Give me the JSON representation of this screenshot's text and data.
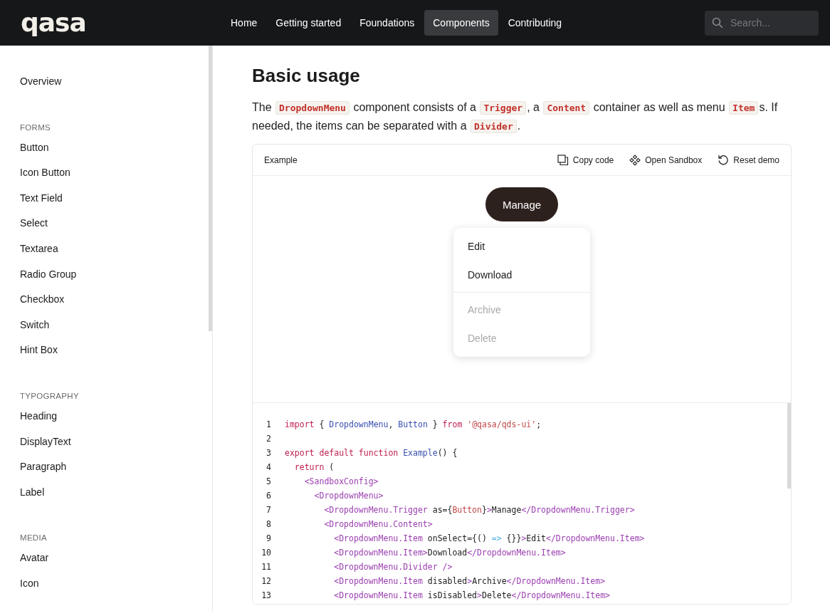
{
  "header": {
    "logo": "qasa",
    "nav": [
      {
        "label": "Home",
        "selected": false
      },
      {
        "label": "Getting started",
        "selected": false
      },
      {
        "label": "Foundations",
        "selected": false
      },
      {
        "label": "Components",
        "selected": true
      },
      {
        "label": "Contributing",
        "selected": false
      }
    ],
    "search": {
      "placeholder": "Search..."
    }
  },
  "sidebar": {
    "sections": [
      {
        "items": [
          {
            "label": "Overview"
          }
        ]
      },
      {
        "title": "FORMS",
        "items": [
          {
            "label": "Button"
          },
          {
            "label": "Icon Button"
          },
          {
            "label": "Text Field"
          },
          {
            "label": "Select"
          },
          {
            "label": "Textarea"
          },
          {
            "label": "Radio Group"
          },
          {
            "label": "Checkbox"
          },
          {
            "label": "Switch"
          },
          {
            "label": "Hint Box"
          }
        ]
      },
      {
        "title": "TYPOGRAPHY",
        "items": [
          {
            "label": "Heading"
          },
          {
            "label": "DisplayText"
          },
          {
            "label": "Paragraph"
          },
          {
            "label": "Label"
          }
        ]
      },
      {
        "title": "MEDIA",
        "items": [
          {
            "label": "Avatar"
          },
          {
            "label": "Icon"
          }
        ]
      }
    ]
  },
  "content": {
    "heading": "Basic usage",
    "paragraph": [
      {
        "kind": "text",
        "text": "The "
      },
      {
        "kind": "code",
        "text": "DropdownMenu"
      },
      {
        "kind": "text",
        "text": " component consists of a "
      },
      {
        "kind": "code",
        "text": "Trigger"
      },
      {
        "kind": "text",
        "text": ", a "
      },
      {
        "kind": "code",
        "text": "Content"
      },
      {
        "kind": "text",
        "text": " container as well as menu "
      },
      {
        "kind": "code",
        "text": "Item"
      },
      {
        "kind": "text",
        "text": "s. If needed, the items can be separated with a "
      },
      {
        "kind": "code",
        "text": "Divider"
      },
      {
        "kind": "text",
        "text": "."
      }
    ],
    "example": {
      "title": "Example",
      "actions": [
        {
          "kind": "copy",
          "label": "Copy code"
        },
        {
          "kind": "sandbox",
          "label": "Open Sandbox"
        },
        {
          "kind": "reset",
          "label": "Reset demo"
        }
      ],
      "trigger": "Manage",
      "menu": [
        {
          "kind": "item",
          "label": "Edit",
          "disabled": false
        },
        {
          "kind": "item",
          "label": "Download",
          "disabled": false
        },
        {
          "kind": "divider"
        },
        {
          "kind": "item",
          "label": "Archive",
          "disabled": true
        },
        {
          "kind": "item",
          "label": "Delete",
          "disabled": true
        }
      ],
      "code": [
        {
          "number": "1",
          "tokens": [
            {
              "kind": "kw",
              "text": "import"
            },
            {
              "kind": "plain",
              "text": " { "
            },
            {
              "kind": "name",
              "text": "DropdownMenu"
            },
            {
              "kind": "plain",
              "text": ", "
            },
            {
              "kind": "name",
              "text": "Button"
            },
            {
              "kind": "plain",
              "text": " } "
            },
            {
              "kind": "kw",
              "text": "from"
            },
            {
              "kind": "str",
              "text": " '@qasa/qds-ui'"
            },
            {
              "kind": "plain",
              "text": ";"
            }
          ]
        },
        {
          "number": "2"
        },
        {
          "number": "3",
          "tokens": [
            {
              "kind": "kw",
              "text": "export default function"
            },
            {
              "kind": "name",
              "text": " Example"
            },
            {
              "kind": "plain",
              "text": "() {"
            }
          ]
        },
        {
          "number": "4",
          "tokens": [
            {
              "kind": "kw",
              "text": "  return"
            },
            {
              "kind": "plain",
              "text": " ("
            }
          ]
        },
        {
          "number": "5",
          "tokens": [
            {
              "kind": "tag",
              "text": "    <SandboxConfig>"
            }
          ]
        },
        {
          "number": "6",
          "tokens": [
            {
              "kind": "tag",
              "text": "      <DropdownMenu>"
            }
          ]
        },
        {
          "number": "7",
          "tokens": [
            {
              "kind": "tag",
              "text": "        <DropdownMenu.Trigger"
            },
            {
              "kind": "plain",
              "text": " as={"
            },
            {
              "kind": "str",
              "text": "Button"
            },
            {
              "kind": "plain",
              "text": "}"
            },
            {
              "kind": "tag",
              "text": ">"
            },
            {
              "kind": "plain",
              "text": "Manage"
            },
            {
              "kind": "tag",
              "text": "</DropdownMenu.Trigger>"
            }
          ]
        },
        {
          "number": "8",
          "tokens": [
            {
              "kind": "tag",
              "text": "        <DropdownMenu.Content>"
            }
          ]
        },
        {
          "number": "9",
          "tokens": [
            {
              "kind": "tag",
              "text": "          <DropdownMenu.Item"
            },
            {
              "kind": "plain",
              "text": " onSelect={() "
            },
            {
              "kind": "arrow",
              "text": "=>"
            },
            {
              "kind": "plain",
              "text": " {}}"
            },
            {
              "kind": "tag",
              "text": ">"
            },
            {
              "kind": "plain",
              "text": "Edit"
            },
            {
              "kind": "tag",
              "text": "</DropdownMenu.Item>"
            }
          ]
        },
        {
          "number": "10",
          "tokens": [
            {
              "kind": "tag",
              "text": "          <DropdownMenu.Item>"
            },
            {
              "kind": "plain",
              "text": "Download"
            },
            {
              "kind": "tag",
              "text": "</DropdownMenu.Item>"
            }
          ]
        },
        {
          "number": "11",
          "tokens": [
            {
              "kind": "tag",
              "text": "          <DropdownMenu.Divider />"
            }
          ]
        },
        {
          "number": "12",
          "tokens": [
            {
              "kind": "tag",
              "text": "          <DropdownMenu.Item"
            },
            {
              "kind": "plain",
              "text": " disabled"
            },
            {
              "kind": "tag",
              "text": ">"
            },
            {
              "kind": "plain",
              "text": "Archive"
            },
            {
              "kind": "tag",
              "text": "</DropdownMenu.Item>"
            }
          ]
        },
        {
          "number": "13",
          "tokens": [
            {
              "kind": "tag",
              "text": "          <DropdownMenu.Item"
            },
            {
              "kind": "plain",
              "text": " isDisabled"
            },
            {
              "kind": "tag",
              "text": ">"
            },
            {
              "kind": "plain",
              "text": "Delete"
            },
            {
              "kind": "tag",
              "text": "</DropdownMenu.Item>"
            }
          ]
        }
      ]
    }
  }
}
